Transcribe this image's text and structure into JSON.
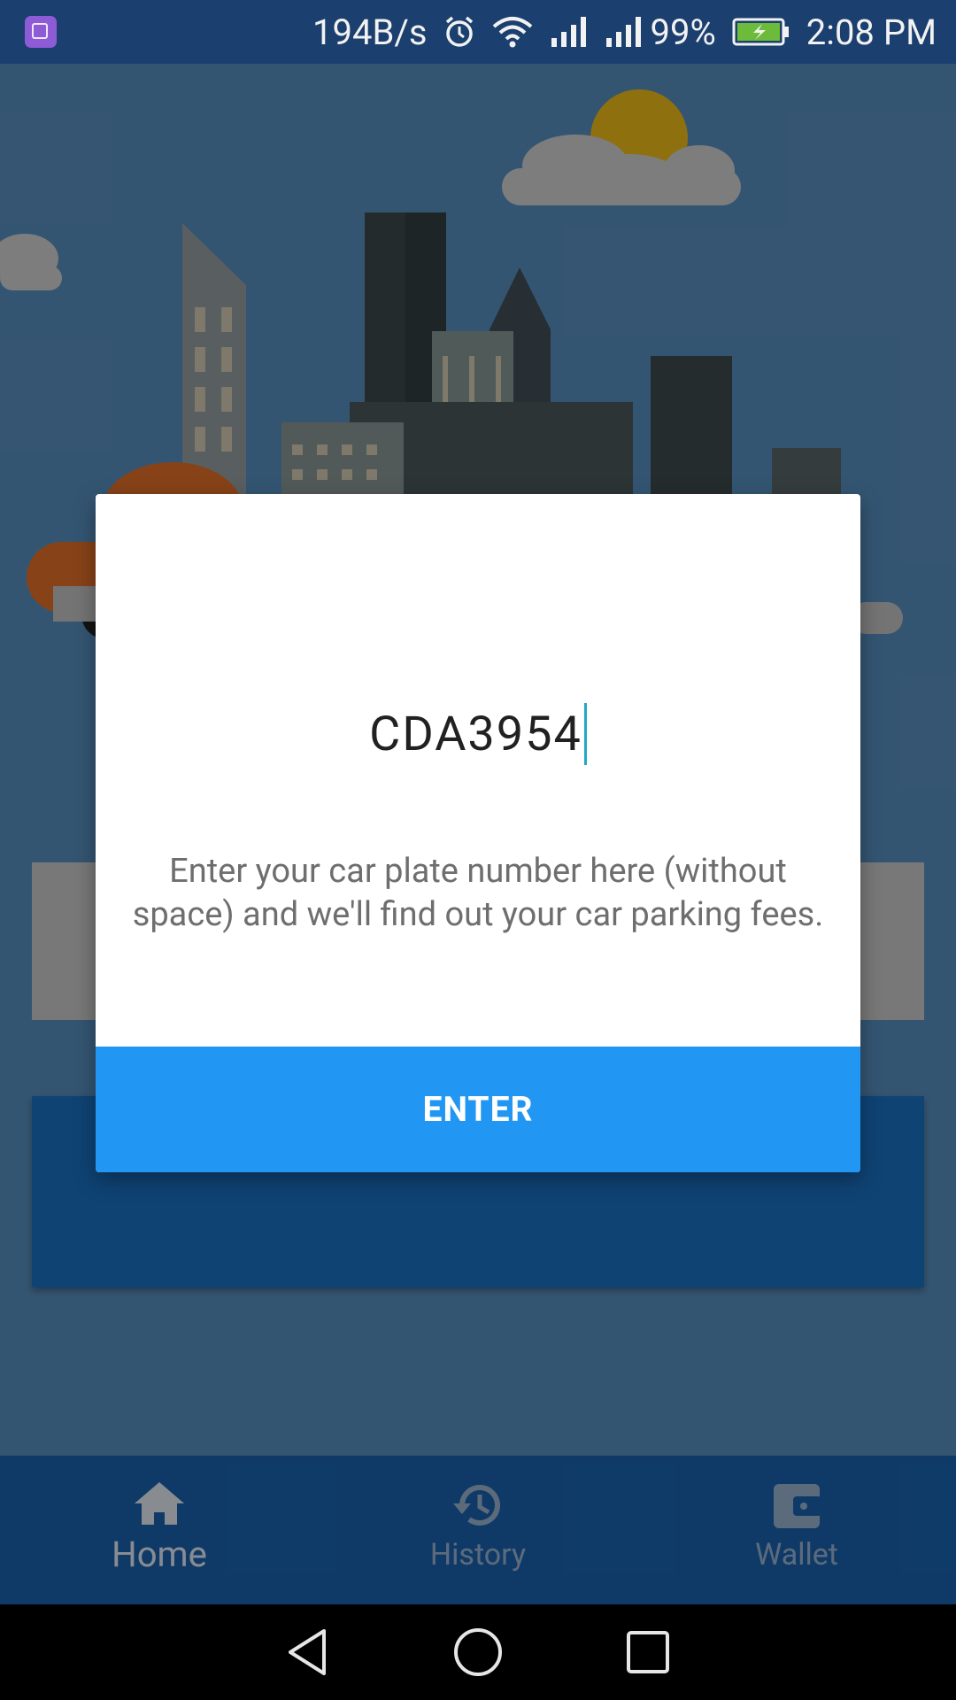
{
  "status_bar": {
    "net_speed": "194B/s",
    "battery": "99%",
    "time": "2:08 PM",
    "icons": [
      "gallery-app-icon",
      "alarm-icon",
      "wifi-icon",
      "signal-icon",
      "signal-icon",
      "battery-charging-icon"
    ]
  },
  "dialog": {
    "plate_value": "CDA3954",
    "hint": "Enter your car plate number here (without space) and we'll find out your car parking fees.",
    "enter_label": "ENTER"
  },
  "bottom_nav": {
    "items": [
      {
        "label": "Home",
        "icon": "home-icon",
        "active": true
      },
      {
        "label": "History",
        "icon": "history-icon",
        "active": false
      },
      {
        "label": "Wallet",
        "icon": "wallet-icon",
        "active": false
      }
    ]
  },
  "system_nav": {
    "icons": [
      "back-icon",
      "home-circle-icon",
      "recents-icon"
    ]
  },
  "colors": {
    "status_bar": "#1b3f6e",
    "app_background": "#5b93c4",
    "enter_button": "#2196f3",
    "bottom_nav": "#1a65b3"
  }
}
